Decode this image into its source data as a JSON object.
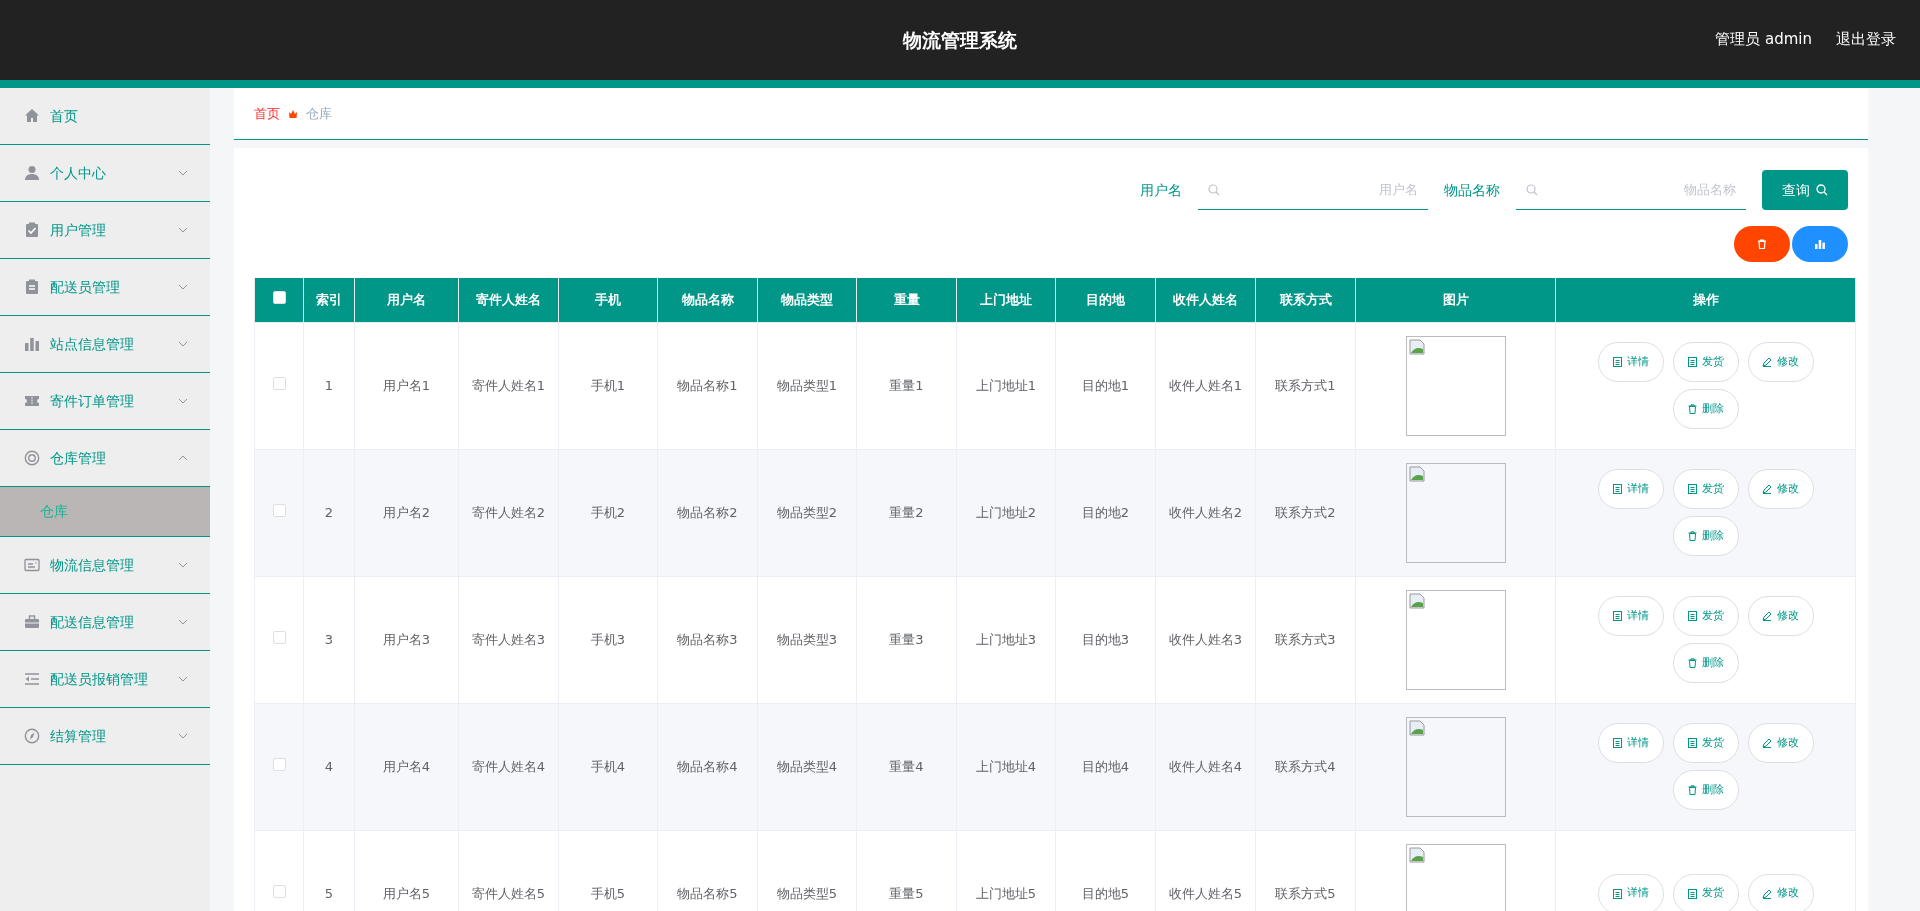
{
  "header": {
    "title": "物流管理系统",
    "user": "管理员 admin",
    "logout": "退出登录"
  },
  "sidebar": {
    "items": [
      {
        "label": "首页",
        "kind": "link"
      },
      {
        "label": "个人中心",
        "kind": "menu",
        "expanded": false
      },
      {
        "label": "用户管理",
        "kind": "menu",
        "expanded": false
      },
      {
        "label": "配送员管理",
        "kind": "menu",
        "expanded": false
      },
      {
        "label": "站点信息管理",
        "kind": "menu",
        "expanded": false
      },
      {
        "label": "寄件订单管理",
        "kind": "menu",
        "expanded": false
      },
      {
        "label": "仓库管理",
        "kind": "menu",
        "expanded": true,
        "children": [
          {
            "label": "仓库",
            "selected": true
          }
        ]
      },
      {
        "label": "物流信息管理",
        "kind": "menu",
        "expanded": false
      },
      {
        "label": "配送信息管理",
        "kind": "menu",
        "expanded": false
      },
      {
        "label": "配送员报销管理",
        "kind": "menu",
        "expanded": false
      },
      {
        "label": "结算管理",
        "kind": "menu",
        "expanded": false
      }
    ]
  },
  "breadcrumb": [
    {
      "label": "首页",
      "current": false
    },
    {
      "label": "仓库",
      "current": true
    }
  ],
  "search": {
    "fields": [
      {
        "label": "用户名",
        "placeholder": "用户名"
      },
      {
        "label": "物品名称",
        "placeholder": "物品名称"
      }
    ],
    "button": "查询"
  },
  "table": {
    "select_all": {
      "checked": false
    },
    "columns": [
      "索引",
      "用户名",
      "寄件人姓名",
      "手机",
      "物品名称",
      "物品类型",
      "重量",
      "上门地址",
      "目的地",
      "收件人姓名",
      "联系方式",
      "图片",
      "操作"
    ],
    "rows": [
      {
        "selected": false,
        "cells": [
          "1",
          "用户名1",
          "寄件人姓名1",
          "手机1",
          "物品名称1",
          "物品类型1",
          "重量1",
          "上门地址1",
          "目的地1",
          "收件人姓名1",
          "联系方式1"
        ],
        "actions": [
          "详情",
          "发货",
          "修改",
          "删除"
        ]
      },
      {
        "selected": false,
        "cells": [
          "2",
          "用户名2",
          "寄件人姓名2",
          "手机2",
          "物品名称2",
          "物品类型2",
          "重量2",
          "上门地址2",
          "目的地2",
          "收件人姓名2",
          "联系方式2"
        ],
        "actions": [
          "详情",
          "发货",
          "修改",
          "删除"
        ]
      },
      {
        "selected": false,
        "cells": [
          "3",
          "用户名3",
          "寄件人姓名3",
          "手机3",
          "物品名称3",
          "物品类型3",
          "重量3",
          "上门地址3",
          "目的地3",
          "收件人姓名3",
          "联系方式3"
        ],
        "actions": [
          "详情",
          "发货",
          "修改",
          "删除"
        ]
      },
      {
        "selected": false,
        "cells": [
          "4",
          "用户名4",
          "寄件人姓名4",
          "手机4",
          "物品名称4",
          "物品类型4",
          "重量4",
          "上门地址4",
          "目的地4",
          "收件人姓名4",
          "联系方式4"
        ],
        "actions": [
          "详情",
          "发货",
          "修改",
          "删除"
        ]
      },
      {
        "selected": false,
        "cells": [
          "5",
          "用户名5",
          "寄件人姓名5",
          "手机5",
          "物品名称5",
          "物品类型5",
          "重量5",
          "上门地址5",
          "目的地5",
          "收件人姓名5",
          "联系方式5"
        ],
        "actions": [
          "详情",
          "发货",
          "修改"
        ]
      }
    ]
  }
}
